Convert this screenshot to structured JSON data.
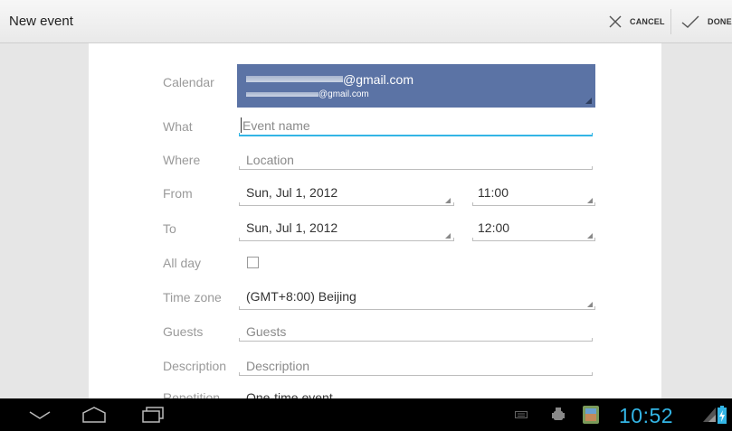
{
  "action_bar": {
    "title": "New event",
    "cancel_label": "CANCEL",
    "done_label": "DONE"
  },
  "form": {
    "calendar": {
      "label": "Calendar",
      "account_primary": "@gmail.com",
      "account_secondary": "@gmail.com"
    },
    "what": {
      "label": "What",
      "placeholder": "Event name"
    },
    "where": {
      "label": "Where",
      "placeholder": "Location"
    },
    "from": {
      "label": "From",
      "date": "Sun, Jul 1, 2012",
      "time": "11:00"
    },
    "to": {
      "label": "To",
      "date": "Sun, Jul 1, 2012",
      "time": "12:00"
    },
    "all_day": {
      "label": "All day",
      "checked": false
    },
    "time_zone": {
      "label": "Time zone",
      "value": "(GMT+8:00) Beijing"
    },
    "guests": {
      "label": "Guests",
      "placeholder": "Guests"
    },
    "description": {
      "label": "Description",
      "placeholder": "Description"
    },
    "repetition": {
      "label": "Repetition",
      "value": "One-time event"
    }
  },
  "nav_bar": {
    "clock": "10:52"
  },
  "colors": {
    "calendar_block": "#5b73a5",
    "accent": "#33b5e5",
    "label": "#9a9a9a"
  }
}
